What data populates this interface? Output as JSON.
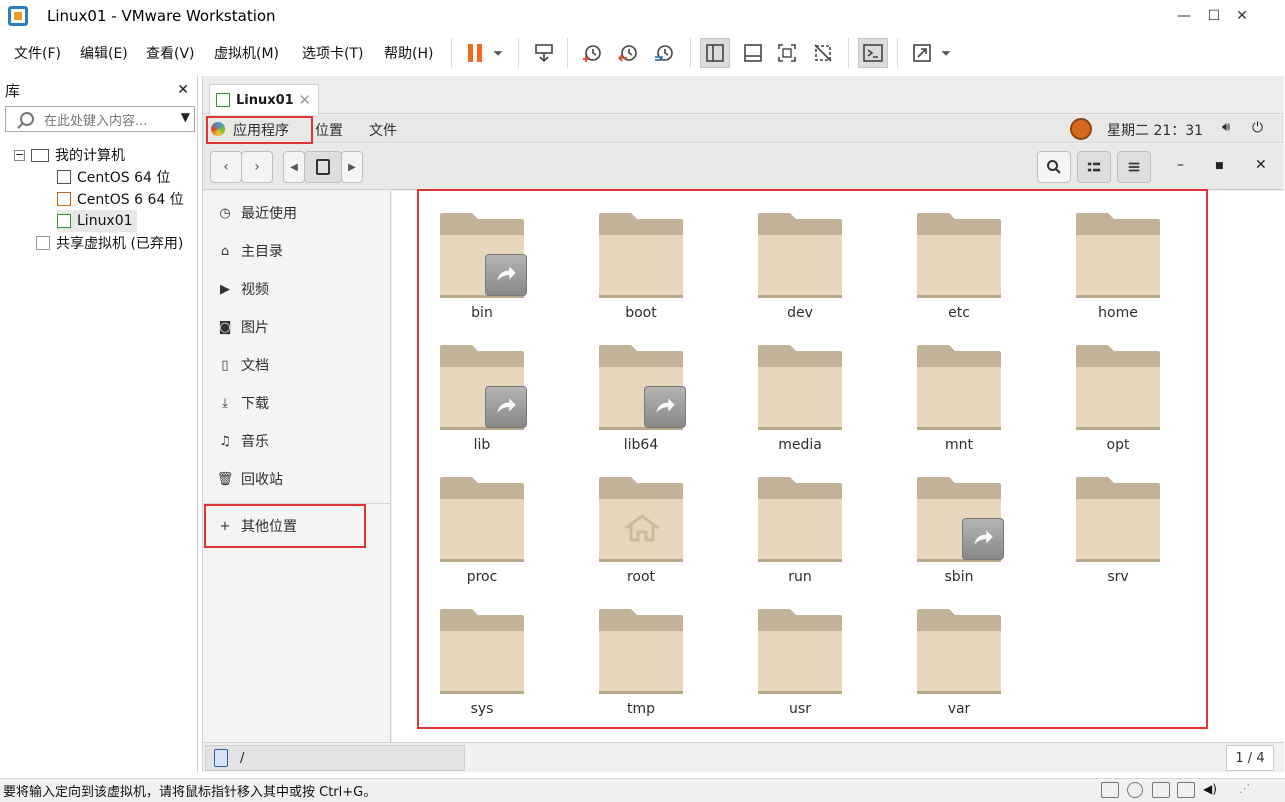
{
  "window": {
    "title": "Linux01 - VMware Workstation",
    "min": "—",
    "max": "☐",
    "close": "✕"
  },
  "menu": {
    "file": "文件(F)",
    "edit": "编辑(E)",
    "view": "查看(V)",
    "vm": "虚拟机(M)",
    "tabs": "选项卡(T)",
    "help": "帮助(H)"
  },
  "library": {
    "title": "库",
    "close": "✕",
    "search_placeholder": "在此处键入内容...",
    "my_computer": "我的计算机",
    "vms": [
      "CentOS 64 位",
      "CentOS 6 64 位",
      "Linux01"
    ],
    "shared": "共享虚拟机 (已弃用)"
  },
  "tab": {
    "label": "Linux01",
    "close": "✕"
  },
  "guest_panel": {
    "apps": "应用程序",
    "places": "位置",
    "files": "文件",
    "clock": "星期二 21：31"
  },
  "sidebar": {
    "items": [
      {
        "label": "最近使用",
        "icon": "clock-icon"
      },
      {
        "label": "主目录",
        "icon": "home-icon"
      },
      {
        "label": "视频",
        "icon": "video-icon"
      },
      {
        "label": "图片",
        "icon": "camera-icon"
      },
      {
        "label": "文档",
        "icon": "document-icon"
      },
      {
        "label": "下载",
        "icon": "download-icon"
      },
      {
        "label": "音乐",
        "icon": "music-icon"
      },
      {
        "label": "回收站",
        "icon": "trash-icon"
      }
    ],
    "other": "其他位置",
    "other_icon": "+"
  },
  "folders": [
    {
      "name": "bin",
      "link": true
    },
    {
      "name": "boot",
      "link": false
    },
    {
      "name": "dev",
      "link": false
    },
    {
      "name": "etc",
      "link": false
    },
    {
      "name": "home",
      "link": false
    },
    {
      "name": "lib",
      "link": true
    },
    {
      "name": "lib64",
      "link": true
    },
    {
      "name": "media",
      "link": false
    },
    {
      "name": "mnt",
      "link": false
    },
    {
      "name": "opt",
      "link": false
    },
    {
      "name": "proc",
      "link": false
    },
    {
      "name": "root",
      "link": false,
      "home_emblem": true
    },
    {
      "name": "run",
      "link": false
    },
    {
      "name": "sbin",
      "link": true
    },
    {
      "name": "srv",
      "link": false
    },
    {
      "name": "sys",
      "link": false
    },
    {
      "name": "tmp",
      "link": false
    },
    {
      "name": "usr",
      "link": false
    },
    {
      "name": "var",
      "link": false
    }
  ],
  "vm_status": {
    "path": "/",
    "pager": "1 / 4"
  },
  "statusbar": {
    "text": "要将输入定向到该虚拟机，请将鼠标指针移入其中或按 Ctrl+G。"
  },
  "colors": {
    "folder_body": "#e6d6bb",
    "folder_tab": "#c2b398",
    "highlight_box": "#e03333",
    "pause_orange": "#f26b1d"
  }
}
